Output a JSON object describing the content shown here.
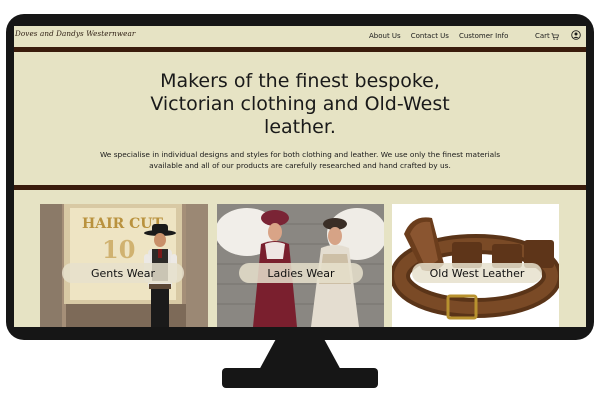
{
  "site": {
    "logo_text": "Doves and Dandys Westernwear"
  },
  "nav": {
    "links": [
      "About Us",
      "Contact Us",
      "Customer Info"
    ],
    "cart_label": "Cart"
  },
  "hero": {
    "title": "Makers of the finest bespoke, Victorian clothing and Old-West leather.",
    "text": "We specialise in individual designs and styles for both clothing and leather. We use only the finest materials available and all of our products are carefully researched and hand crafted by us."
  },
  "categories": [
    {
      "label": "Gents Wear",
      "photo_sign": "HAIR CUT"
    },
    {
      "label": "Ladies Wear"
    },
    {
      "label": "Old West Leather"
    }
  ],
  "colors": {
    "page_background": "#e6e3c4",
    "divider": "#3a1c0c",
    "monitor": "#161616"
  },
  "icons": [
    "cart-icon",
    "user-account-icon"
  ]
}
